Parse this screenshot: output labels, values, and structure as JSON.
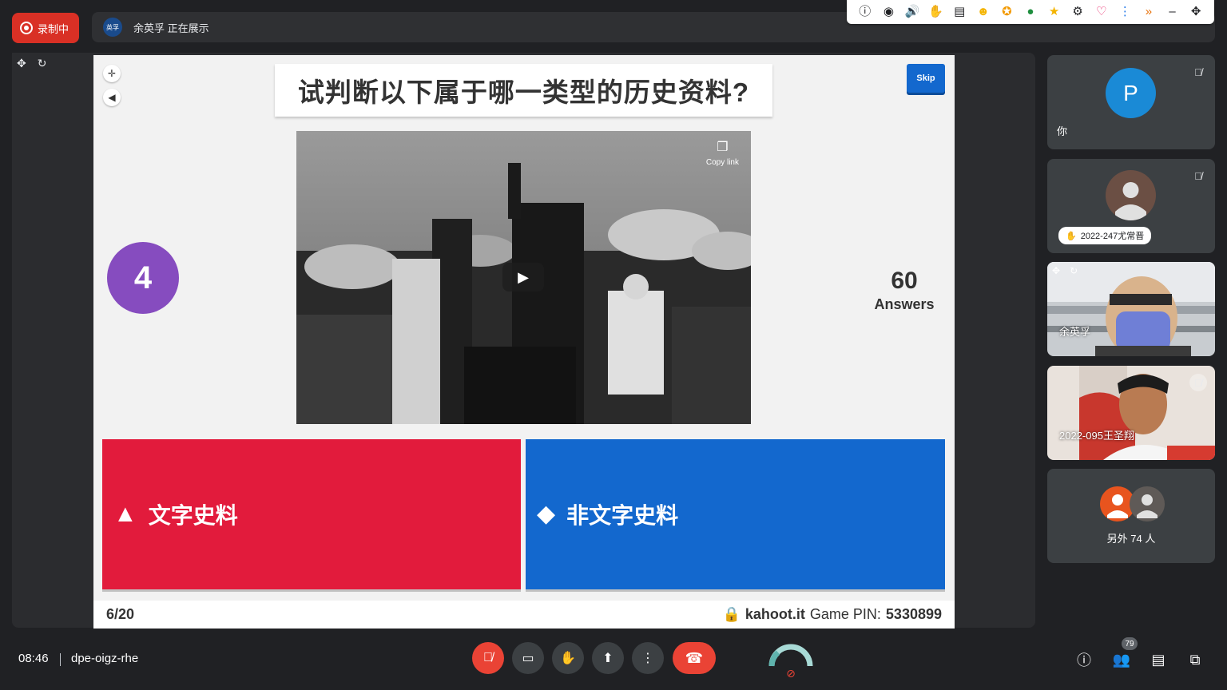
{
  "recording": {
    "label": "录制中"
  },
  "presenter": {
    "avatar_text": "英孚",
    "text": "余英孚 正在展示"
  },
  "extension_icons": [
    "info-icon",
    "eye-icon",
    "speaker-icon",
    "hand-icon",
    "notes-icon",
    "emoji-icon",
    "badge-icon",
    "chat-icon",
    "star-icon",
    "gear-icon",
    "heart-icon",
    "more-icon",
    "chevrons-icon",
    "minimize-icon",
    "move-icon"
  ],
  "slide": {
    "question": "试判断以下属于哪一类型的历史资料?",
    "skip_label": "Skip",
    "copy_link_label": "Copy link",
    "timer": "4",
    "answers_count": "60",
    "answers_label": "Answers",
    "answer_red": "文字史料",
    "answer_blue": "非文字史料",
    "progress": "6/20",
    "site": "kahoot.it",
    "pin_label": "Game PIN:",
    "pin": "5330899"
  },
  "participants": [
    {
      "name": "你",
      "initial": "P"
    },
    {
      "name": "2022-247尤常晋"
    },
    {
      "name": "余英孚"
    },
    {
      "name": "2022-095王圣翔"
    },
    {
      "name": "另外 74 人"
    }
  ],
  "bottom": {
    "time": "08:46",
    "meeting_code": "dpe-oigz-rhe",
    "participant_count": "79"
  },
  "colors": {
    "red_answer": "#e21b3c",
    "blue_answer": "#1368ce",
    "timer_purple": "#864cbf",
    "recording_red": "#d93025",
    "meet_bg": "#202124"
  }
}
